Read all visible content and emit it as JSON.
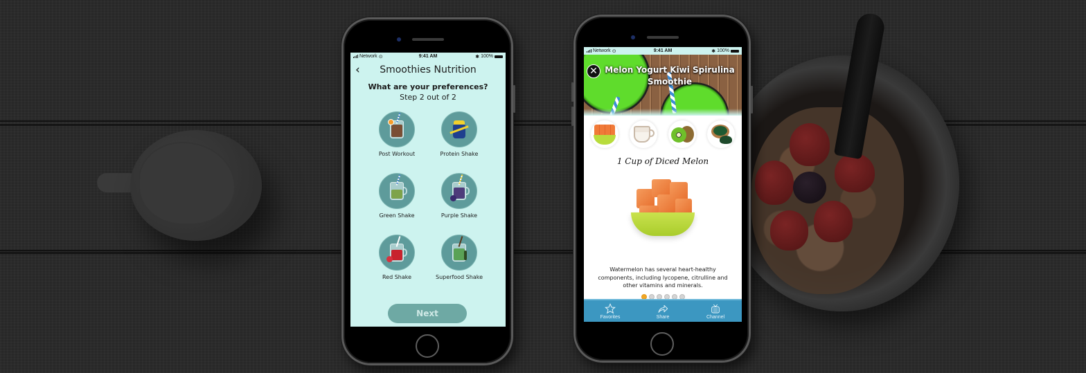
{
  "phone_left": {
    "status_bar": {
      "carrier": "Network",
      "time": "9:41 AM",
      "battery": "100%"
    },
    "nav": {
      "back_icon": "chevron-left-icon",
      "title": "Smoothies Nutrition"
    },
    "prompt": "What are your preferences?",
    "step": "Step 2 out of 2",
    "options": [
      {
        "label": "Post Workout",
        "icon": "iced-coffee-jar-icon"
      },
      {
        "label": "Protein Shake",
        "icon": "protein-shaker-icon"
      },
      {
        "label": "Green Shake",
        "icon": "green-shake-jar-icon"
      },
      {
        "label": "Purple Shake",
        "icon": "purple-shake-jar-icon"
      },
      {
        "label": "Red Shake",
        "icon": "red-shake-jar-icon"
      },
      {
        "label": "Superfood Shake",
        "icon": "superfood-jar-icon"
      }
    ],
    "next_button": "Next",
    "colors": {
      "background": "#cdf3ef",
      "circle": "#5e9b9b",
      "button": "#6ea9a4"
    }
  },
  "phone_right": {
    "status_bar": {
      "carrier": "Network",
      "time": "9:41 AM",
      "battery": "100%"
    },
    "close_icon": "close-icon",
    "recipe_title": "Melon Yogurt Kiwi Spirulina Smoothie",
    "ingredients": [
      {
        "name": "melon"
      },
      {
        "name": "yogurt"
      },
      {
        "name": "kiwi"
      },
      {
        "name": "spirulina"
      }
    ],
    "ingredient_title": "1 Cup of Diced Melon",
    "ingredient_description": "Watermelon has several heart-healthy components, including lycopene, citrulline and other vitamins and minerals.",
    "pager": {
      "total": 6,
      "active_index": 0
    },
    "tabbar": [
      {
        "label": "Favorites",
        "icon": "star-icon"
      },
      {
        "label": "Share",
        "icon": "share-arrow-icon"
      },
      {
        "label": "Channel",
        "icon": "tv-icon"
      }
    ],
    "colors": {
      "tabbar": "#3c97c1",
      "pager_active": "#f2a624",
      "pager_inactive": "#d4d4d4"
    }
  }
}
